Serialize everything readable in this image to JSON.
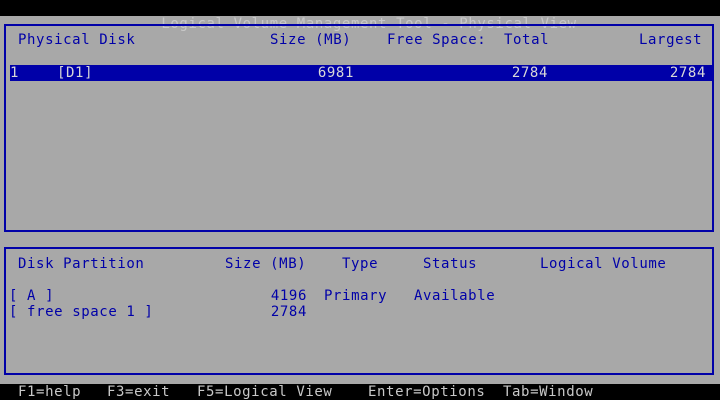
{
  "window": {
    "title": "Logical Volume Management Tool - Physical View"
  },
  "disk_panel": {
    "columns": {
      "physical_disk": "Physical Disk",
      "size": "Size (MB)",
      "free_space": "Free Space:",
      "total": "Total",
      "largest": "Largest"
    },
    "rows": [
      {
        "index": "1",
        "name": "[D1]",
        "size": "6981",
        "total": "2784",
        "largest": "2784"
      }
    ]
  },
  "partition_panel": {
    "columns": {
      "disk_partition": "Disk Partition",
      "size": "Size (MB)",
      "type": "Type",
      "status": "Status",
      "logical_volume": "Logical Volume"
    },
    "rows": [
      {
        "name": "[ A ]",
        "size": "4196",
        "type": "Primary",
        "status": "Available",
        "logical_volume": ""
      },
      {
        "name": "[ free space 1 ]",
        "size": "2784",
        "type": "",
        "status": "",
        "logical_volume": ""
      }
    ]
  },
  "footer": {
    "keys": [
      "F1=help",
      "F3=exit",
      "F5=Logical View",
      "Enter=Options",
      "Tab=Window"
    ]
  },
  "colors": {
    "background": "#a8a8a8",
    "text": "#0000a8",
    "bars": "#000000",
    "bar_text": "#c8c8c8"
  }
}
